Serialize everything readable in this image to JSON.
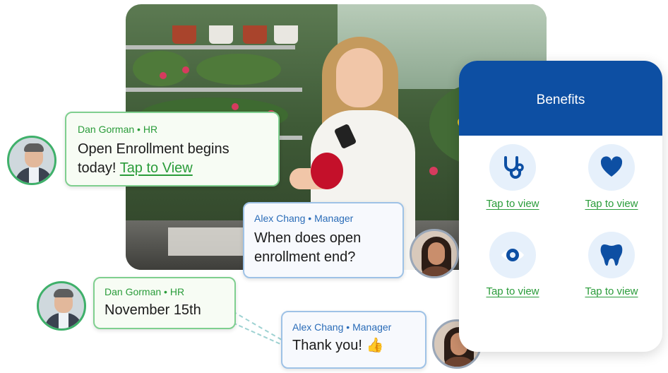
{
  "chat": [
    {
      "sender": "Dan Gorman",
      "role": "HR",
      "separator": "•",
      "text": "Open Enrollment begins today!",
      "link": "Tap to View"
    },
    {
      "sender": "Alex Chang",
      "role": "Manager",
      "separator": "•",
      "text_line1": "When does open",
      "text_line2": "enrollment end?"
    },
    {
      "sender": "Dan Gorman",
      "role": "HR",
      "separator": "•",
      "text": "November 15th"
    },
    {
      "sender": "Alex Chang",
      "role": "Manager",
      "separator": "•",
      "text": "Thank you!",
      "emoji": "👍"
    }
  ],
  "card": {
    "title": "Benefits",
    "tiles": [
      {
        "icon": "stethoscope-icon",
        "link": "Tap to view"
      },
      {
        "icon": "heart-icon",
        "link": "Tap to view"
      },
      {
        "icon": "eye-icon",
        "link": "Tap to view"
      },
      {
        "icon": "tooth-icon",
        "link": "Tap to view"
      }
    ]
  },
  "colors": {
    "hr_green": "#2a9c3a",
    "manager_blue": "#2a6cb8",
    "header_blue": "#0d4fa3",
    "icon_bg": "#e6f0fb"
  }
}
